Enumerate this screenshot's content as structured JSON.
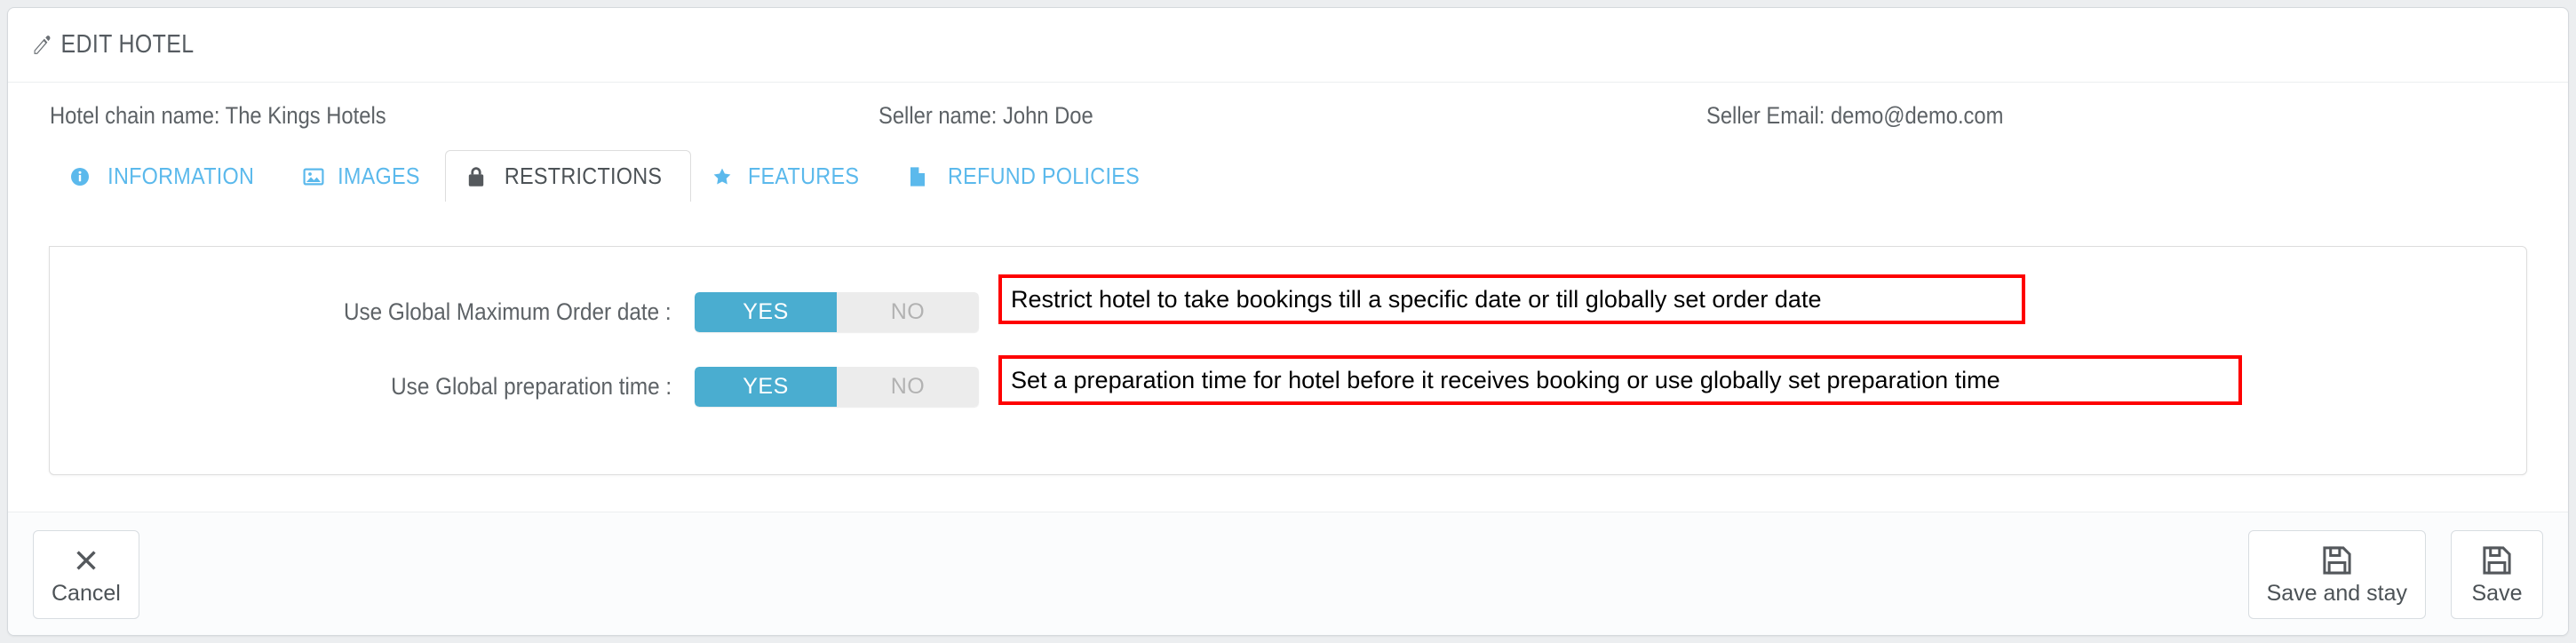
{
  "header": {
    "title": "EDIT HOTEL",
    "icon": "pencil-icon"
  },
  "info": {
    "hotel_chain": "Hotel chain name: The Kings Hotels",
    "seller_name": "Seller name: John Doe",
    "seller_email": "Seller Email: demo@demo.com"
  },
  "tabs": [
    {
      "label": "INFORMATION",
      "icon": "info-circle-icon",
      "active": false
    },
    {
      "label": "IMAGES",
      "icon": "picture-icon",
      "active": false
    },
    {
      "label": "RESTRICTIONS",
      "icon": "lock-icon",
      "active": true
    },
    {
      "label": "FEATURES",
      "icon": "star-icon",
      "active": false
    },
    {
      "label": "REFUND POLICIES",
      "icon": "file-icon",
      "active": false
    }
  ],
  "restrictions": {
    "rows": [
      {
        "label": "Use Global Maximum Order date :",
        "yes_label": "YES",
        "no_label": "NO",
        "value": "YES"
      },
      {
        "label": "Use Global preparation time :",
        "yes_label": "YES",
        "no_label": "NO",
        "value": "YES"
      }
    ]
  },
  "annotations": [
    {
      "text": "Restrict hotel to take bookings till a specific date or till globally set order date"
    },
    {
      "text": "Set a preparation time for hotel before it receives booking or use globally set preparation time"
    }
  ],
  "footer": {
    "cancel_label": "Cancel",
    "save_and_stay_label": "Save and stay",
    "save_label": "Save"
  },
  "colors": {
    "accent_blue": "#5bb9ec",
    "toggle_on": "#4aadd0",
    "toggle_off": "#ececec",
    "annotation_red": "#fe0000",
    "text_dark": "#4c5256",
    "text_muted": "#5d6266"
  }
}
